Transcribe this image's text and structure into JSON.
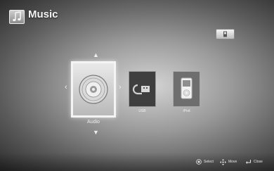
{
  "header": {
    "title": "Music",
    "icon": "music-note-icon"
  },
  "menu": {
    "items": [
      {
        "label": "Audio",
        "icon": "disc-icon",
        "selected": true
      },
      {
        "label": "USB",
        "icon": "usb-plug-icon",
        "selected": false
      },
      {
        "label": "iPod",
        "icon": "ipod-icon",
        "selected": false
      }
    ]
  },
  "footer": {
    "hints": [
      {
        "label": "Select",
        "icon": "enter-button-icon"
      },
      {
        "label": "Move",
        "icon": "dpad-icon"
      },
      {
        "label": "Close",
        "icon": "return-icon"
      }
    ]
  },
  "colors": {
    "highlight": "#f4f4f4",
    "text": "#f0f0f0"
  }
}
